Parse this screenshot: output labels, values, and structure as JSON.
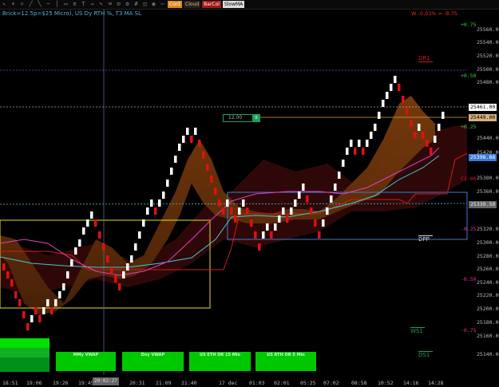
{
  "toolbar": {
    "cont": "Cont",
    "cloud": "Cloud",
    "barcol": "BarCol",
    "slowma": "SlowMA"
  },
  "header": {
    "title": "Brick=12.5p=$25 Micro), US Dy RTH %, T3 MA SL",
    "pnl": "W -0.03% = -8.75"
  },
  "price_axis": [
    "25560.00",
    "25540.00",
    "25520.00",
    "25500.00",
    "25480.00",
    "25440.00",
    "25420.00",
    "25380.00",
    "25360.00",
    "25320.00",
    "25300.00",
    "25280.00",
    "25260.00",
    "25240.00",
    "25220.00",
    "25200.00",
    "25180.00",
    "25160.00",
    "25140.00"
  ],
  "price_boxes": {
    "current": "25461.00",
    "level_1": "25449.00",
    "level_2": "25398.88",
    "level_3": "25339.50"
  },
  "pct_labels": {
    "p075": "+0.75",
    "p050": "+0.50",
    "p025": "+0.25",
    "m025": "-0.25",
    "m050": "-0.50",
    "m075": "-0.75",
    "c00": "C1:00"
  },
  "levels": {
    "dr1": "DR1",
    "dpp": "DPP",
    "ws1": "WS1",
    "ds1": "DS1"
  },
  "info_box": {
    "value": "12.00",
    "badge": "0"
  },
  "vwap_boxes": [
    "MMy VWAP",
    "Dny VWAP",
    "US ETH OR 15 Min",
    "US RTH OR 5 Min"
  ],
  "time_axis": [
    "18:51",
    "19:06",
    "19:26",
    "19:45",
    "20:31",
    "21:09",
    "21:40",
    "17 dec",
    "01:03",
    "02:01",
    "05:25",
    "07:02",
    "08:58",
    "10:52",
    "14:16",
    "14:28"
  ],
  "crosshair_time": "20:02:27",
  "colors": {
    "cloud": "#8a4a10",
    "cloud_dark": "#3a0a0a",
    "up_brick": "#ffffff",
    "down_brick": "#e01010",
    "fast_ma": "#e040c0",
    "slow_ma": "#40d0d0",
    "stop_line": "#e01010",
    "or_box": "#e8e020",
    "dpp_box": "#3a7ad8"
  }
}
